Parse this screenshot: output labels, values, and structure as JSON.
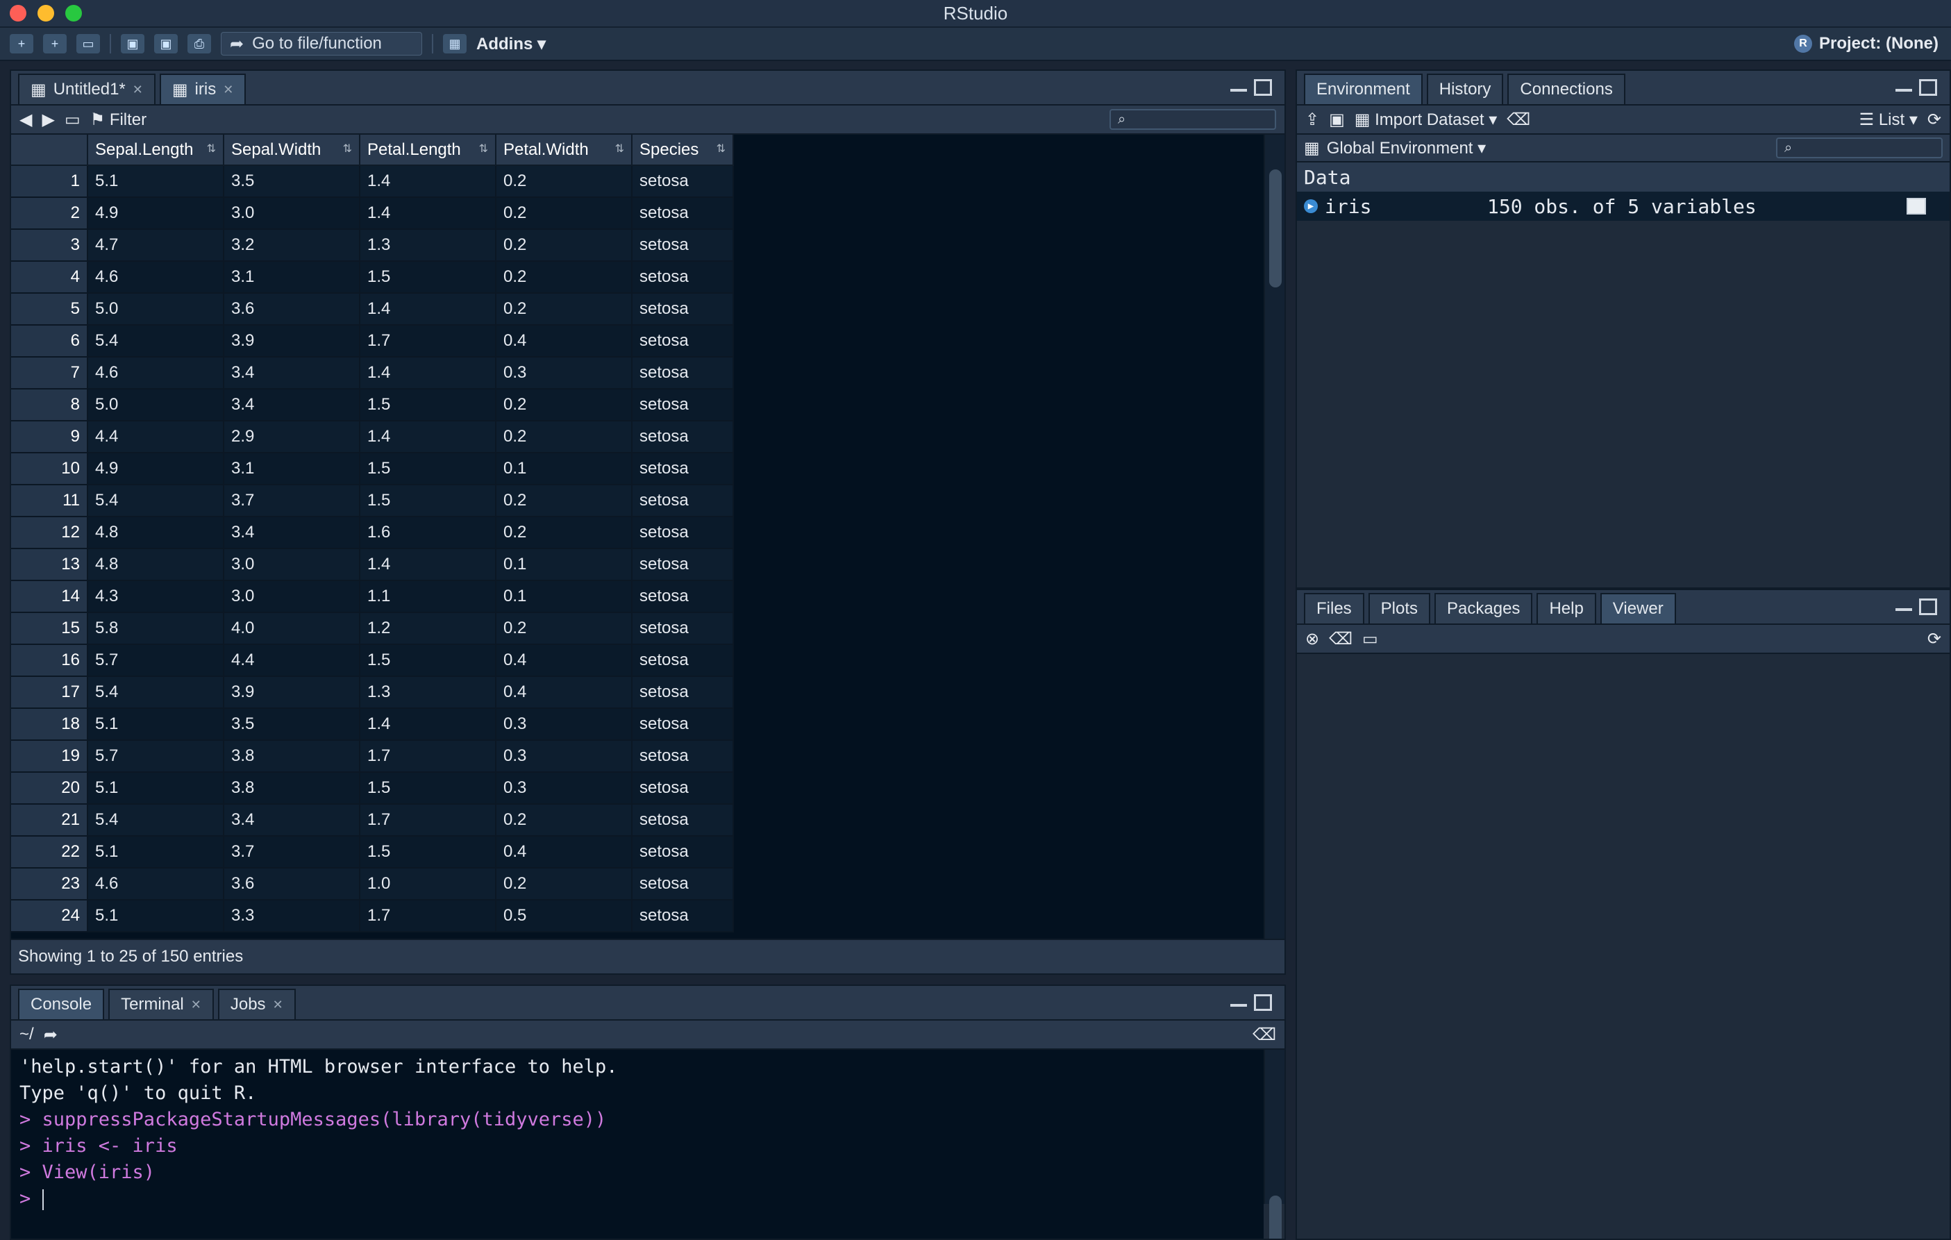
{
  "window": {
    "title": "RStudio"
  },
  "toolbar": {
    "goto_label": "Go to file/function",
    "addins_label": "Addins",
    "project_label": "Project: (None)"
  },
  "source": {
    "tabs": [
      {
        "label": "Untitled1*"
      },
      {
        "label": "iris"
      }
    ],
    "filter_label": "Filter",
    "columns": [
      "Sepal.Length",
      "Sepal.Width",
      "Petal.Length",
      "Petal.Width",
      "Species"
    ],
    "rows": [
      [
        "1",
        "5.1",
        "3.5",
        "1.4",
        "0.2",
        "setosa"
      ],
      [
        "2",
        "4.9",
        "3.0",
        "1.4",
        "0.2",
        "setosa"
      ],
      [
        "3",
        "4.7",
        "3.2",
        "1.3",
        "0.2",
        "setosa"
      ],
      [
        "4",
        "4.6",
        "3.1",
        "1.5",
        "0.2",
        "setosa"
      ],
      [
        "5",
        "5.0",
        "3.6",
        "1.4",
        "0.2",
        "setosa"
      ],
      [
        "6",
        "5.4",
        "3.9",
        "1.7",
        "0.4",
        "setosa"
      ],
      [
        "7",
        "4.6",
        "3.4",
        "1.4",
        "0.3",
        "setosa"
      ],
      [
        "8",
        "5.0",
        "3.4",
        "1.5",
        "0.2",
        "setosa"
      ],
      [
        "9",
        "4.4",
        "2.9",
        "1.4",
        "0.2",
        "setosa"
      ],
      [
        "10",
        "4.9",
        "3.1",
        "1.5",
        "0.1",
        "setosa"
      ],
      [
        "11",
        "5.4",
        "3.7",
        "1.5",
        "0.2",
        "setosa"
      ],
      [
        "12",
        "4.8",
        "3.4",
        "1.6",
        "0.2",
        "setosa"
      ],
      [
        "13",
        "4.8",
        "3.0",
        "1.4",
        "0.1",
        "setosa"
      ],
      [
        "14",
        "4.3",
        "3.0",
        "1.1",
        "0.1",
        "setosa"
      ],
      [
        "15",
        "5.8",
        "4.0",
        "1.2",
        "0.2",
        "setosa"
      ],
      [
        "16",
        "5.7",
        "4.4",
        "1.5",
        "0.4",
        "setosa"
      ],
      [
        "17",
        "5.4",
        "3.9",
        "1.3",
        "0.4",
        "setosa"
      ],
      [
        "18",
        "5.1",
        "3.5",
        "1.4",
        "0.3",
        "setosa"
      ],
      [
        "19",
        "5.7",
        "3.8",
        "1.7",
        "0.3",
        "setosa"
      ],
      [
        "20",
        "5.1",
        "3.8",
        "1.5",
        "0.3",
        "setosa"
      ],
      [
        "21",
        "5.4",
        "3.4",
        "1.7",
        "0.2",
        "setosa"
      ],
      [
        "22",
        "5.1",
        "3.7",
        "1.5",
        "0.4",
        "setosa"
      ],
      [
        "23",
        "4.6",
        "3.6",
        "1.0",
        "0.2",
        "setosa"
      ],
      [
        "24",
        "5.1",
        "3.3",
        "1.7",
        "0.5",
        "setosa"
      ]
    ],
    "footer": "Showing 1 to 25 of 150 entries"
  },
  "console": {
    "tabs": [
      {
        "label": "Console"
      },
      {
        "label": "Terminal"
      },
      {
        "label": "Jobs"
      }
    ],
    "path": "~/",
    "lines": [
      {
        "text": "'help.start()' for an HTML browser interface to help.",
        "type": "output"
      },
      {
        "text": "Type 'q()' to quit R.",
        "type": "output"
      },
      {
        "text": "",
        "type": "output"
      },
      {
        "text": "> suppressPackageStartupMessages(library(tidyverse))",
        "type": "input"
      },
      {
        "text": "> iris <- iris",
        "type": "input"
      },
      {
        "text": "> View(iris)",
        "type": "input"
      },
      {
        "text": ">",
        "type": "prompt"
      }
    ]
  },
  "env": {
    "tabs": [
      {
        "label": "Environment"
      },
      {
        "label": "History"
      },
      {
        "label": "Connections"
      }
    ],
    "import_label": "Import Dataset",
    "list_label": "List",
    "scope_label": "Global Environment",
    "data_header": "Data",
    "items": [
      {
        "name": "iris",
        "desc": "150 obs. of 5 variables"
      }
    ]
  },
  "files": {
    "tabs": [
      {
        "label": "Files"
      },
      {
        "label": "Plots"
      },
      {
        "label": "Packages"
      },
      {
        "label": "Help"
      },
      {
        "label": "Viewer"
      }
    ]
  }
}
